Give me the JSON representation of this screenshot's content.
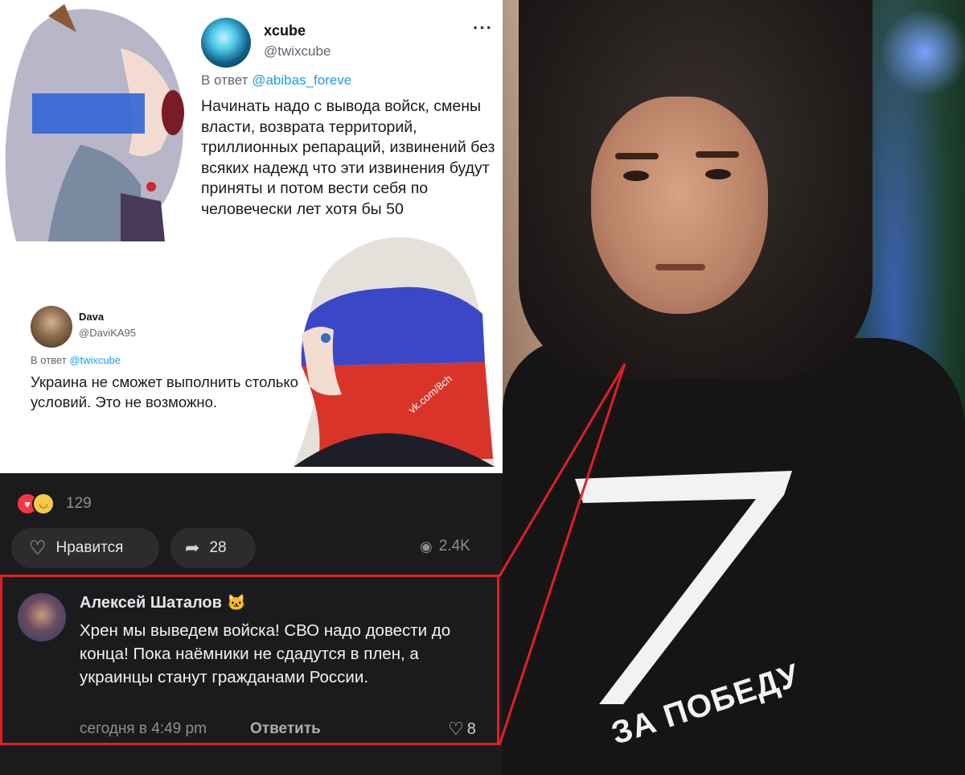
{
  "tweet1": {
    "author_name": "xcube",
    "author_handle": "@twixcube",
    "more_icon": "more-dots-icon",
    "reply_prefix": "В ответ",
    "reply_to": "@abibas_foreve",
    "text": "Начинать надо с вывода войск, смены власти, возврата территорий, триллионных репараций, извинений без всяких надежд что эти извинения будут приняты и потом вести себя по человечески лет хотя бы 50"
  },
  "tweet2": {
    "author_name": "Dava",
    "author_handle": "@DaviKA95",
    "reply_prefix": "В ответ",
    "reply_to": "@twixcube",
    "text": "Украина не сможет выполнить столько условий. Это не возможно."
  },
  "watermark": "vk.com/8ch",
  "post_stats": {
    "reactions_count": "129",
    "like_label": "Нравится",
    "share_count": "28",
    "views": "2.4K"
  },
  "comment": {
    "author": "Алексей Шаталов",
    "author_emoji": "🐱",
    "text": "Хрен мы выведем войска! СВО надо довести до конца! Пока наёмники не сдадутся в плен, а украинцы станут гражданами России.",
    "time": "сегодня в 4:49 pm",
    "reply_label": "Ответить",
    "likes": "8"
  },
  "photo": {
    "shirt_slogan": "ЗА ПОБЕДУ"
  },
  "colors": {
    "highlight": "#e01f26",
    "mention": "#1d9bf0",
    "feed_bg": "#1b1b1d"
  }
}
